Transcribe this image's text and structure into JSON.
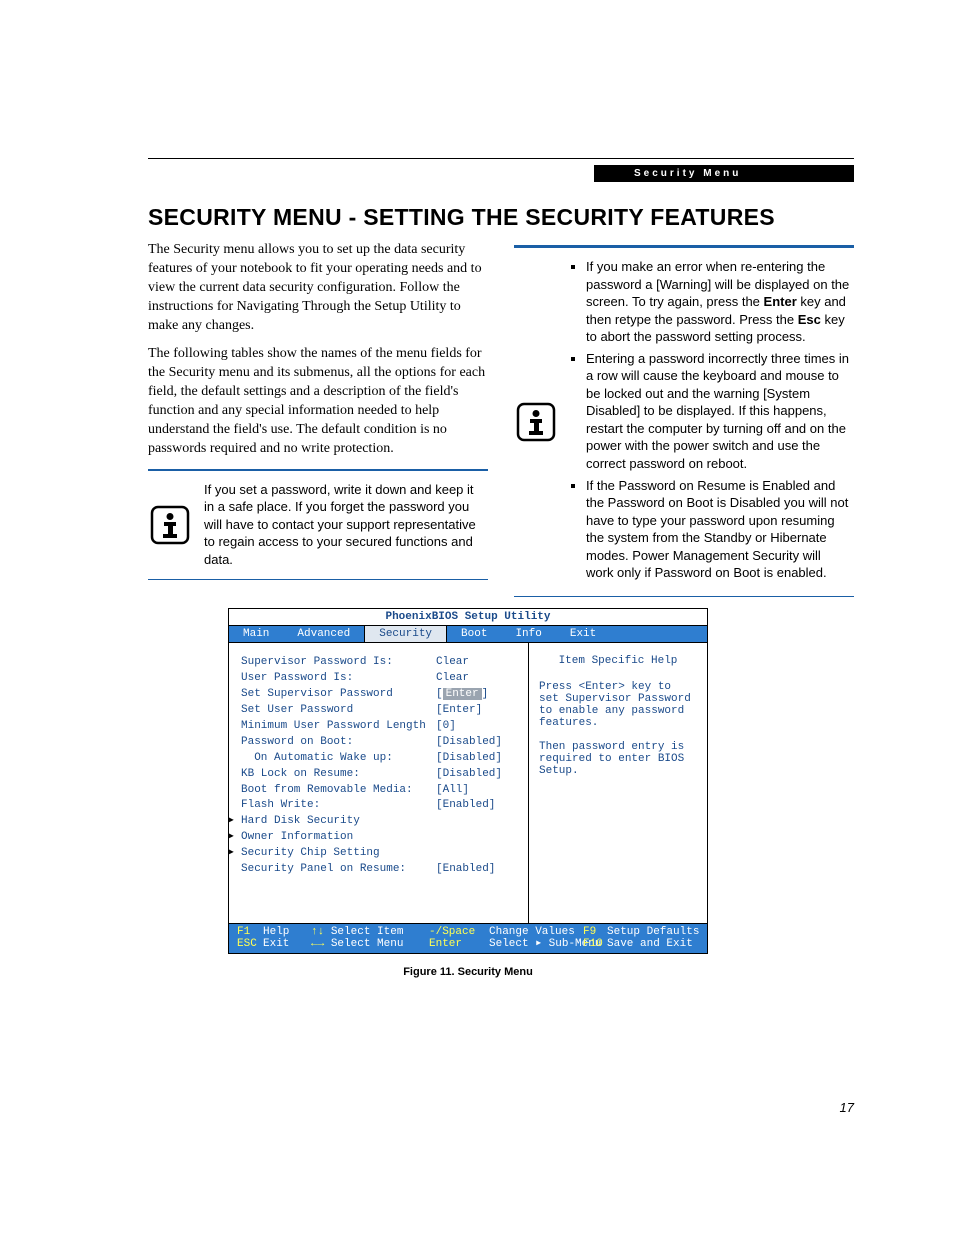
{
  "header_bar": "Security Menu",
  "title": "SECURITY MENU - SETTING THE SECURITY FEATURES",
  "para1": "The Security menu allows you to set up the data security features of your notebook to fit your operating needs and to view the current data security configuration. Follow the instructions for Navigating Through the Setup Utility to make any changes.",
  "para2": "The following tables show the names of the menu fields for the Security menu and its submenus, all the options for each field, the default settings and a description of the field's function and any special information needed to help understand the field's use. The default condition is no passwords required and no write protection.",
  "note1": "If you set a password, write it down and keep it in a safe place. If you forget the password you will have to contact your support representative to regain access to your secured functions and data.",
  "note2_b1a": "If you make an error when re-entering the password a [Warning] will be displayed on the screen. To try again, press the ",
  "note2_b1_key1": "Enter",
  "note2_b1b": " key and then retype the password. Press the ",
  "note2_b1_key2": "Esc",
  "note2_b1c": " key to abort the password setting process.",
  "note2_b2": "Entering a password incorrectly three times in a row will cause the keyboard and mouse to be locked out and the warning [System Disabled] to be displayed. If this happens, restart the computer by turning off and on the power with the power switch and use the correct password on reboot.",
  "note2_b3": "If the Password on Resume is Enabled and the Password on Boot is Disabled you will not have to type your password upon resuming the system from the Standby or Hibernate modes. Power Management Security will work only if Password on Boot is enabled.",
  "bios": {
    "window_title": "PhoenixBIOS Setup Utility",
    "tabs": [
      "Main",
      "Advanced",
      "Security",
      "Boot",
      "Info",
      "Exit"
    ],
    "active_tab": "Security",
    "help_title": "Item Specific Help",
    "help_body_1": "Press <Enter> key to set Supervisor Password to enable any password features.",
    "help_body_2": "Then password entry is required to enter BIOS Setup.",
    "rows": [
      {
        "label": "Supervisor Password Is:",
        "value": "Clear"
      },
      {
        "label": "User Password Is:",
        "value": "Clear"
      },
      {
        "label": "",
        "value": ""
      },
      {
        "label": "Set Supervisor Password",
        "value": "[Enter]",
        "selected": true
      },
      {
        "label": "Set User Password",
        "value": "[Enter]"
      },
      {
        "label": "Minimum User Password Length",
        "value": "[0]"
      },
      {
        "label": "Password on Boot:",
        "value": "[Disabled]"
      },
      {
        "label": "  On Automatic Wake up:",
        "value": "[Disabled]"
      },
      {
        "label": "KB Lock on Resume:",
        "value": "[Disabled]"
      },
      {
        "label": "Boot from Removable Media:",
        "value": "[All]"
      },
      {
        "label": "Flash Write:",
        "value": "[Enabled]"
      },
      {
        "label": "Hard Disk Security",
        "value": "",
        "submenu": true
      },
      {
        "label": "Owner Information",
        "value": "",
        "submenu": true
      },
      {
        "label": "Security Chip Setting",
        "value": "",
        "submenu": true
      },
      {
        "label": "Security Panel on Resume:",
        "value": "[Enabled]"
      }
    ],
    "footer": {
      "f1": "F1",
      "help": "Help",
      "selitem_key": "↑↓ ",
      "selitem": "Select Item",
      "chg_key": "-/Space",
      "chg": "Change Values",
      "f9": "F9",
      "setupdef": "Setup Defaults",
      "esc": "ESC",
      "exit": "Exit",
      "selmenu_key": "←→ ",
      "selmenu": "Select Menu",
      "enter": "Enter",
      "selsub": "Select ",
      "submenu": "Sub-Menu",
      "f10": "F10",
      "save": "Save and Exit"
    }
  },
  "fig_caption": "Figure 11.  Security Menu",
  "page_number": "17"
}
